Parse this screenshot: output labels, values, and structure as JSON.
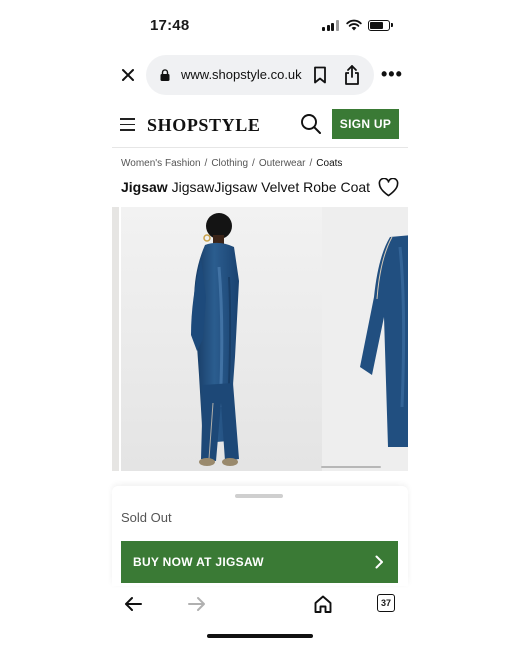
{
  "status_bar": {
    "time": "17:48",
    "icons": [
      "signal-icon",
      "wifi-icon",
      "battery-icon"
    ]
  },
  "browser": {
    "url": "www.shopstyle.co.uk",
    "close_icon": "close-icon",
    "lock_icon": "lock-icon",
    "bookmark_icon": "bookmark-icon",
    "share_icon": "share-icon",
    "more_label": "•••"
  },
  "site_header": {
    "logo": "SHOPSTYLE",
    "menu_icon": "hamburger-icon",
    "search_icon": "search-icon",
    "signup_label": "SIGN UP",
    "accent_color": "#3a7a35"
  },
  "breadcrumbs": [
    {
      "label": "Women's Fashion"
    },
    {
      "label": "Clothing"
    },
    {
      "label": "Outerwear"
    },
    {
      "label": "Coats"
    }
  ],
  "breadcrumb_separator": "/",
  "product": {
    "brand": "Jigsaw",
    "name": "JigsawJigsaw Velvet Robe Coat",
    "favorite_icon": "heart-icon",
    "images": [
      "product-image-back-view",
      "product-image-front-detail"
    ]
  },
  "purchase": {
    "status": "Sold Out",
    "buy_label": "BUY NOW AT JIGSAW",
    "buy_icon": "chevron-right-icon"
  },
  "toolbar": {
    "back_icon": "arrow-left-icon",
    "forward_icon": "arrow-right-icon",
    "home_icon": "home-icon",
    "tab_count": "37"
  }
}
